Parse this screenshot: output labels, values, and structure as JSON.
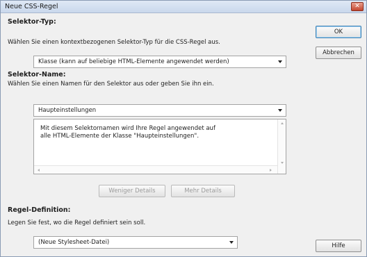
{
  "window": {
    "title": "Neue CSS-Regel",
    "close_glyph": "✕"
  },
  "selector_type": {
    "heading": "Selektor-Typ:",
    "description": "Wählen Sie einen kontextbezogenen Selektor-Typ für die CSS-Regel aus.",
    "selected_value": "Klasse (kann auf beliebige HTML-Elemente angewendet werden)"
  },
  "selector_name": {
    "heading": "Selektor-Name:",
    "description": "Wählen Sie einen Namen für den Selektor aus oder geben Sie ihn ein.",
    "value": "Haupteinstellungen",
    "info_line1": "Mit diesem Selektornamen wird Ihre Regel angewendet auf",
    "info_line2": "alle HTML-Elemente der Klasse \"Haupteinstellungen\"."
  },
  "detail_buttons": {
    "less_details": "Weniger Details",
    "more_details": "Mehr Details"
  },
  "rule_definition": {
    "heading": "Regel-Definition:",
    "description": "Legen Sie fest, wo die Regel definiert sein soll.",
    "selected_value": "(Neue Stylesheet-Datei)"
  },
  "buttons": {
    "ok": "OK",
    "cancel": "Abbrechen",
    "help": "Hilfe"
  },
  "colors": {
    "accent_border": "#3c7fb1",
    "close_red": "#c3472f",
    "titlebar": "#c9d8ec"
  }
}
